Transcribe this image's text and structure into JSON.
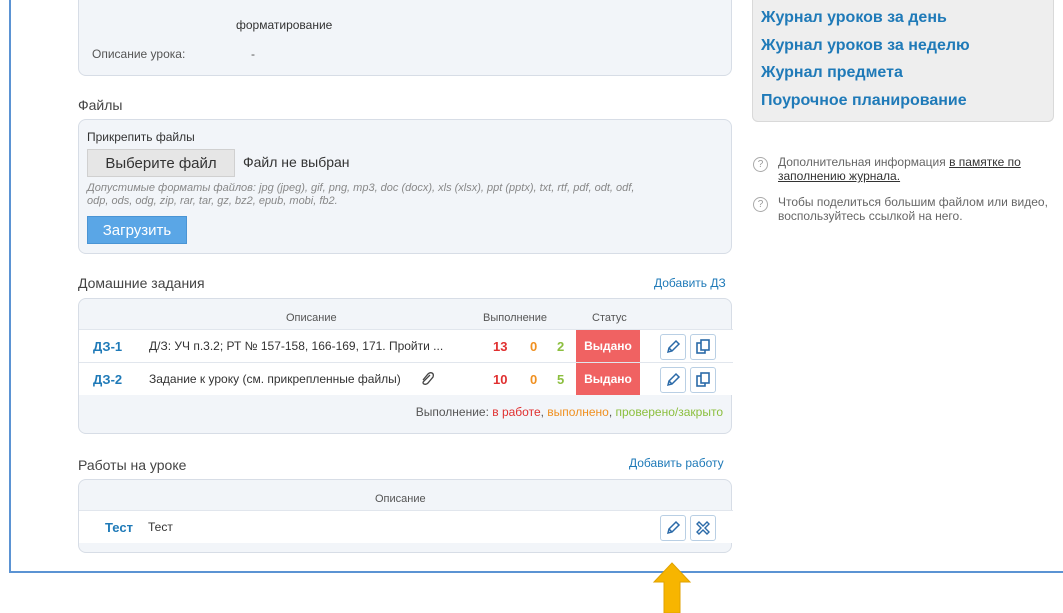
{
  "lesson": {
    "cut_text": "форматирование",
    "description_label": "Описание урока:",
    "description_value": "-"
  },
  "files": {
    "section_title": "Файлы",
    "attach_label": "Прикрепить файлы",
    "choose_button": "Выберите файл",
    "no_file": "Файл не выбран",
    "formats_line1": "Допустимые форматы файлов: jpg (jpeg), gif, png, mp3, doc (docx), xls (xlsx), ppt (pptx), txt, rtf, pdf, odt, odf,",
    "formats_line2": "odp, ods, odg, zip, rar, tar, gz, bz2, epub, mobi, fb2.",
    "upload_button": "Загрузить"
  },
  "homework": {
    "section_title": "Домашние задания",
    "add_link": "Добавить ДЗ",
    "columns": {
      "description": "Описание",
      "completion": "Выполнение",
      "status": "Статус"
    },
    "rows": [
      {
        "code": "ДЗ-1",
        "description": "Д/З: УЧ п.3.2; РТ № 157-158, 166-169, 171. Пройти ...",
        "in_work": "13",
        "done": "0",
        "checked": "2",
        "status": "Выдано"
      },
      {
        "code": "ДЗ-2",
        "description": "Задание к уроку (см. прикрепленные файлы)",
        "in_work": "10",
        "done": "0",
        "checked": "5",
        "status": "Выдано"
      }
    ],
    "legend": {
      "prefix": "Выполнение: ",
      "in_work": "в работе",
      "sep": ", ",
      "done": "выполнено",
      "checked": "проверено/закрыто"
    }
  },
  "classwork": {
    "section_title": "Работы на уроке",
    "add_link": "Добавить работу",
    "column_description": "Описание",
    "rows": [
      {
        "code": "Тест",
        "description": "Тест"
      }
    ]
  },
  "sidebar": {
    "menu": [
      "Журнал уроков за день",
      "Журнал уроков за неделю",
      "Журнал предмета",
      "Поурочное планирование"
    ],
    "info1_prefix": "Дополнительная информация ",
    "info1_link": "в памятке по заполнению журнала.",
    "info2": "Чтобы поделиться большим файлом или видео, воспользуйтесь ссылкой на него."
  },
  "colors": {
    "accent": "#1f7ab8",
    "status_bg": "#f06262",
    "in_work": "#e03030",
    "done": "#f09020",
    "checked": "#8cbf3f",
    "arrow": "#f7b500"
  },
  "icons": [
    "pencil-icon",
    "copy-icon",
    "delete-icon",
    "paperclip-icon",
    "question-icon",
    "arrow-up-icon"
  ]
}
